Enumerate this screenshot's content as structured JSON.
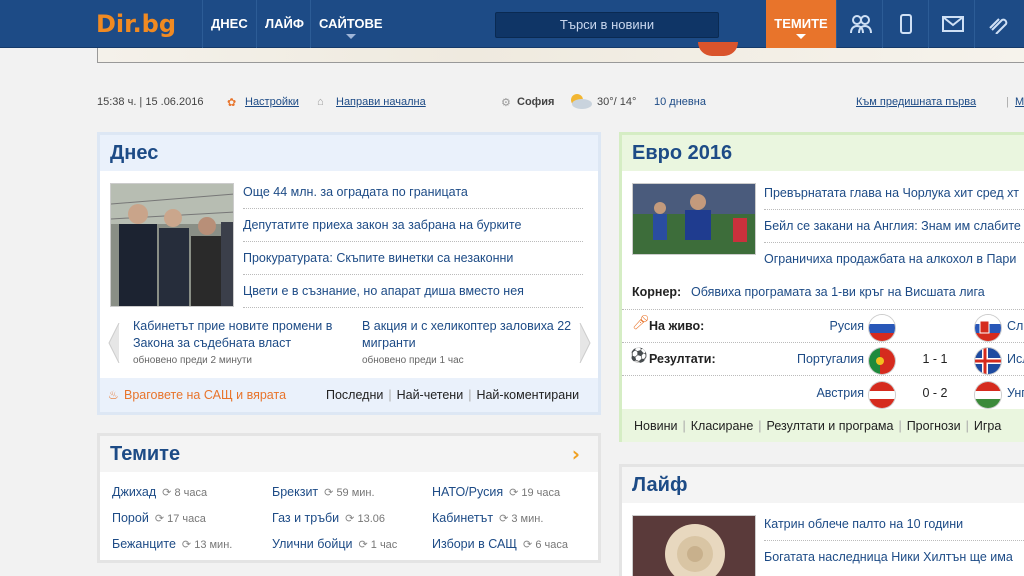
{
  "nav": {
    "logo_text": "Dir.bg",
    "items": [
      "ДНЕС",
      "ЛАЙФ",
      "САЙТОВЕ"
    ],
    "search_placeholder": "Търси в новини",
    "themes_label": "ТЕМИТЕ",
    "icons": [
      "users-icon",
      "mobile-icon",
      "mail-icon",
      "attach-icon"
    ]
  },
  "info": {
    "datetime": "15:38 ч. | 15 .06.2016",
    "settings": "Настройки",
    "make_home": "Направи начална",
    "city": "София",
    "temps": "30°/ 14°",
    "forecast": "10 дневна",
    "prev_link": "Към предишната първа",
    "extra": "М"
  },
  "today": {
    "title": "Днес",
    "headlines": [
      "Още 44 млн. за оградата по границата",
      "Депутатите приеха закон за забрана на бурките",
      "Прокуратурата: Скъпите винетки са незаконни",
      "Цвети е в съзнание, но апарат диша вместо нея"
    ],
    "sub": [
      {
        "text": "Кабинетът прие новите промени в Закона за съдебната власт",
        "time": "обновено преди 2 минути"
      },
      {
        "text": "В акция и с хеликоптер заловиха 22 мигранти",
        "time": "обновено преди 1 час"
      }
    ],
    "hot_link": "Враговете на САЩ и вярата",
    "tabs": [
      "Последни",
      "Най-четени",
      "Най-коментирани"
    ]
  },
  "euro": {
    "title": "Евро 2016",
    "headlines": [
      "Превърнатата глава на Чорлука хит сред хт",
      "Бейл се закани на Англия: Знам им слабите",
      "Ограничиха продажбата на алкохол в Пари"
    ],
    "corner_label": "Корнер:",
    "corner_text": "Обявиха програмата за 1-ви кръг на Висшата лига",
    "live_label": "На живо:",
    "results_label": "Резултати:",
    "matches": [
      {
        "home": "Русия",
        "score": "",
        "away": "Сло"
      },
      {
        "home": "Португалия",
        "score": "1 - 1",
        "away": "Исл"
      },
      {
        "home": "Австрия",
        "score": "0 - 2",
        "away": "Унг"
      }
    ],
    "tabs": [
      "Новини",
      "Класиране",
      "Резултати и програма",
      "Прогнози",
      "Игра"
    ]
  },
  "themes": {
    "title": "Темите",
    "items": [
      {
        "name": "Джихад",
        "time": "8 часа"
      },
      {
        "name": "Брекзит",
        "time": "59 мин."
      },
      {
        "name": "НАТО/Русия",
        "time": "19 часа"
      },
      {
        "name": "Порой",
        "time": "17 часа"
      },
      {
        "name": "Газ и тръби",
        "time": "13.06"
      },
      {
        "name": "Кабинетът",
        "time": "3 мин."
      },
      {
        "name": "Бежанците",
        "time": "13 мин."
      },
      {
        "name": "Улични бойци",
        "time": "1 час"
      },
      {
        "name": "Избори в САЩ",
        "time": "6 часа"
      }
    ]
  },
  "life": {
    "title": "Лайф",
    "headlines": [
      "Катрин облече палто на 10 години",
      "Богатата наследница Ники Хилтън ще има"
    ]
  },
  "colors": {
    "nav_bg": "#1d4b86",
    "accent_orange": "#e8742b",
    "link_blue": "#1d4b86"
  }
}
